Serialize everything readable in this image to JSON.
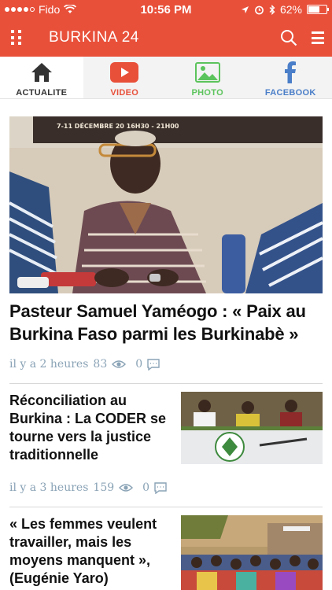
{
  "status_bar": {
    "carrier": "Fido",
    "time": "10:56 PM",
    "battery": "62%",
    "battery_level": 0.62
  },
  "app_bar": {
    "title": "BURKINA 24",
    "grid_icon": "grid-icon",
    "search_icon": "search-icon",
    "menu_icon": "hamburger-menu-icon"
  },
  "tabs": [
    {
      "label": "ACTUALITE",
      "icon": "home-icon",
      "color": "#333333",
      "active": true
    },
    {
      "label": "VIDEO",
      "icon": "play-icon",
      "color": "#e8503a",
      "active": false
    },
    {
      "label": "PHOTO",
      "icon": "photo-icon",
      "color": "#5cc45c",
      "active": false
    },
    {
      "label": "FACEBOOK",
      "icon": "facebook-icon",
      "color": "#4a7ec8",
      "active": false
    }
  ],
  "hero": {
    "title": "Pasteur Samuel Yaméogo : « Paix au Burkina Faso parmi les Burkinabè »",
    "time": "il y a 2 heures",
    "views": "83",
    "comments": "0",
    "banner_text": "7-11 DÉCEMBRE 20   16H30 - 21H00"
  },
  "articles": [
    {
      "title": "Réconciliation au Burkina : La CODER se tourne vers la justice traditionnelle",
      "time": "il y a 3 heures",
      "views": "159",
      "comments": "0"
    },
    {
      "title": "« Les femmes veulent travailler, mais les moyens manquent », (Eugénie Yaro)",
      "time": "",
      "views": "",
      "comments": ""
    }
  ],
  "colors": {
    "brand": "#e8503a",
    "meta": "#8aa3b6"
  }
}
